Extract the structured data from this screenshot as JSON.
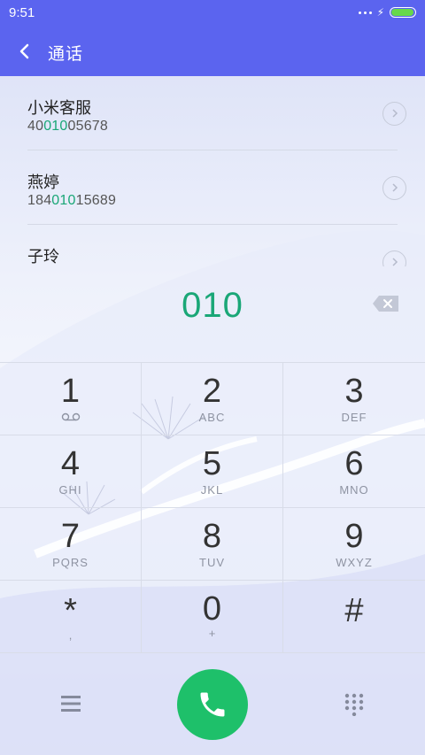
{
  "status_bar": {
    "time": "9:51",
    "battery_level": 1.0
  },
  "app_bar": {
    "title": "通话",
    "back_icon": "chevron-left-icon"
  },
  "contacts": [
    {
      "name": "小米客服",
      "number_prefix": "40",
      "number_match": "010",
      "number_suffix": "05678"
    },
    {
      "name": "燕婷",
      "number_prefix": "184",
      "number_match": "010",
      "number_suffix": "15689"
    },
    {
      "name": "子玲",
      "number_prefix": "",
      "number_match": "",
      "number_suffix": ""
    }
  ],
  "entry": {
    "number": "010"
  },
  "keypad": [
    {
      "digit": "1",
      "letters": ""
    },
    {
      "digit": "2",
      "letters": "ABC"
    },
    {
      "digit": "3",
      "letters": "DEF"
    },
    {
      "digit": "4",
      "letters": "GHI"
    },
    {
      "digit": "5",
      "letters": "JKL"
    },
    {
      "digit": "6",
      "letters": "MNO"
    },
    {
      "digit": "7",
      "letters": "PQRS"
    },
    {
      "digit": "8",
      "letters": "TUV"
    },
    {
      "digit": "9",
      "letters": "WXYZ"
    },
    {
      "digit": "*",
      "letters": ","
    },
    {
      "digit": "0",
      "letters": "+"
    },
    {
      "digit": "#",
      "letters": ""
    }
  ],
  "colors": {
    "accent": "#5b64ef",
    "match_green": "#1aa777",
    "call_green": "#1ec06a"
  },
  "icons": {
    "voicemail": "voicemail-icon",
    "backspace": "backspace-icon",
    "menu": "menu-icon",
    "call": "phone-icon",
    "dialpad": "dialpad-icon"
  }
}
